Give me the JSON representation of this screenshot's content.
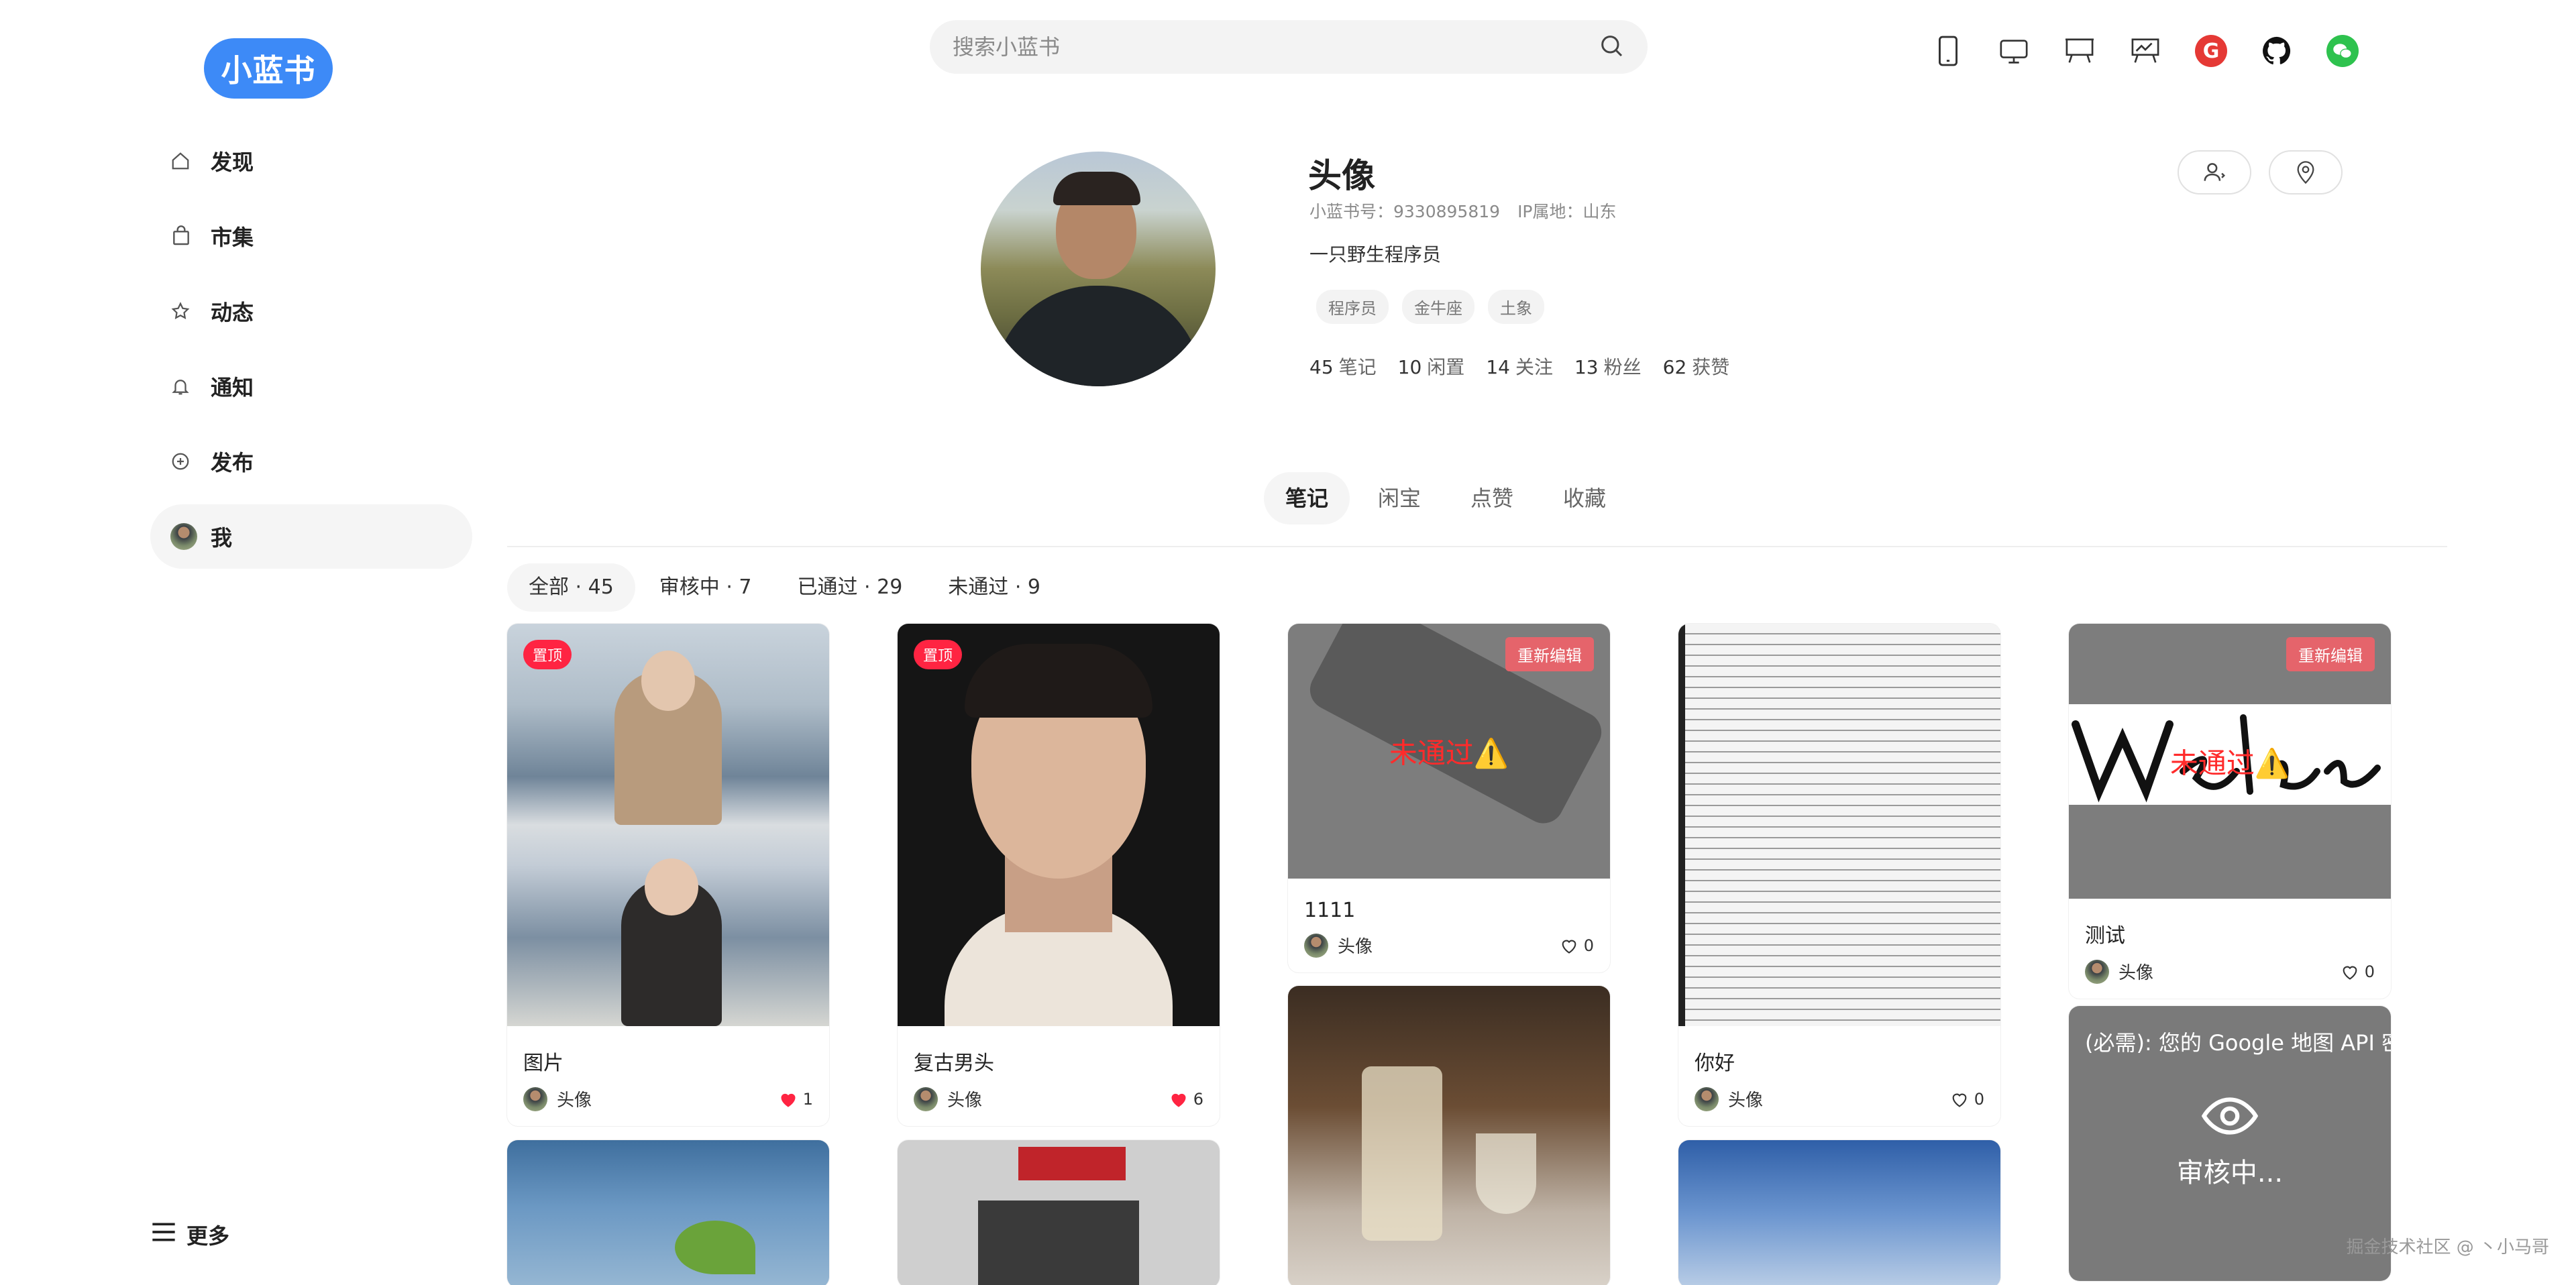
{
  "sidebar": {
    "logo": "小蓝书",
    "items": [
      {
        "label": "发现",
        "icon": "home-icon"
      },
      {
        "label": "市集",
        "icon": "shopping-bag-icon"
      },
      {
        "label": "动态",
        "icon": "star-icon"
      },
      {
        "label": "通知",
        "icon": "bell-icon"
      },
      {
        "label": "发布",
        "icon": "plus-circle-icon"
      },
      {
        "label": "我",
        "icon": "avatar"
      }
    ],
    "more": "更多"
  },
  "search": {
    "placeholder": "搜索小蓝书"
  },
  "top_icons": [
    "phone-icon",
    "monitor-icon",
    "board-icon",
    "chart-board-icon",
    "g-badge-icon",
    "github-icon",
    "wechat-icon"
  ],
  "profile": {
    "name": "头像",
    "id_text": "小蓝书号：9330895819",
    "ip_text": "IP属地：山东",
    "bio": "一只野生程序员",
    "tags": [
      "程序员",
      "金牛座",
      "土象"
    ],
    "stats": [
      {
        "num": "45",
        "label": "笔记"
      },
      {
        "num": "10",
        "label": "闲置"
      },
      {
        "num": "14",
        "label": "关注"
      },
      {
        "num": "13",
        "label": "粉丝"
      },
      {
        "num": "62",
        "label": "获赞"
      }
    ]
  },
  "tabs": [
    "笔记",
    "闲宝",
    "点赞",
    "收藏"
  ],
  "subtabs": [
    "全部 · 45",
    "审核中 · 7",
    "已通过 · 29",
    "未通过 · 9"
  ],
  "cards": [
    {
      "title": "图片",
      "author": "头像",
      "likes": "1",
      "badge": "置顶"
    },
    {
      "title": "复古男头",
      "author": "头像",
      "likes": "6",
      "badge": "置顶"
    },
    {
      "title": "1111",
      "author": "头像",
      "likes": "0",
      "badge": "重新编辑",
      "status": "未通过⚠️"
    },
    {
      "title": "你好",
      "author": "头像",
      "likes": "0"
    },
    {
      "title": "测试",
      "author": "头像",
      "likes": "0",
      "badge": "重新编辑",
      "status": "未通过⚠️"
    },
    {
      "review_text": "审核中...",
      "error_text": "(必需): 您的 Google 地图 API 密"
    }
  ],
  "watermark": "掘金技术社区 @ 丶小马哥",
  "colors": {
    "brand": "#3d8af7",
    "like": "#ff2442",
    "reject": "#ff2b2b"
  }
}
